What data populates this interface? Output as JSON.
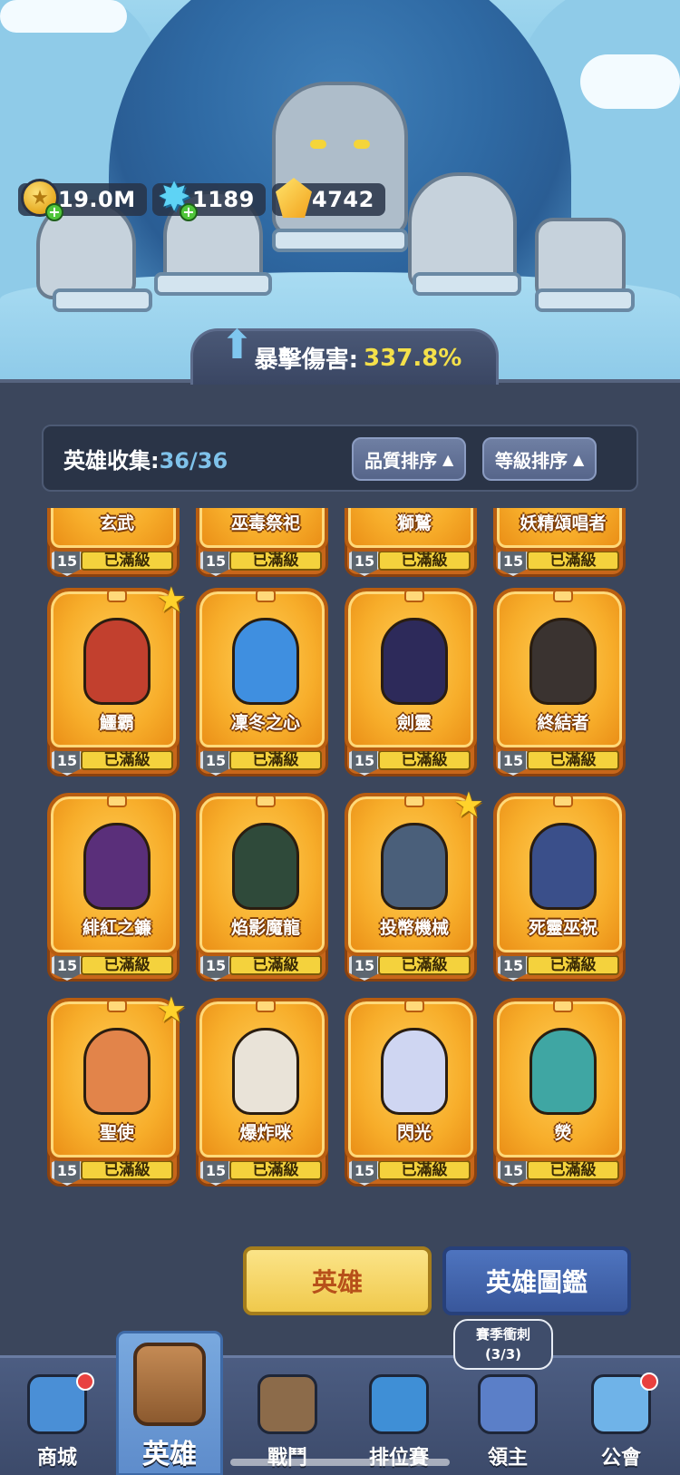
{
  "currencies": {
    "gold": "19.0M",
    "stars": "1189",
    "crystals": "4742"
  },
  "crit_banner": {
    "label": "暴擊傷害:",
    "value": "337.8%"
  },
  "collection": {
    "label": "英雄收集:",
    "count": "36/36",
    "sort_quality": "品質排序",
    "sort_level": "等級排序"
  },
  "heroes": [
    {
      "name": "玄武",
      "level": "15",
      "status": "已滿級",
      "favorite": false
    },
    {
      "name": "巫毒祭祀",
      "level": "15",
      "status": "已滿級",
      "favorite": false
    },
    {
      "name": "獅鷲",
      "level": "15",
      "status": "已滿級",
      "favorite": false
    },
    {
      "name": "妖精頌唱者",
      "level": "15",
      "status": "已滿級",
      "favorite": false
    },
    {
      "name": "鱷霸",
      "level": "15",
      "status": "已滿級",
      "favorite": true
    },
    {
      "name": "凜冬之心",
      "level": "15",
      "status": "已滿級",
      "favorite": false
    },
    {
      "name": "劍靈",
      "level": "15",
      "status": "已滿級",
      "favorite": false
    },
    {
      "name": "終結者",
      "level": "15",
      "status": "已滿級",
      "favorite": false
    },
    {
      "name": "緋紅之鐮",
      "level": "15",
      "status": "已滿級",
      "favorite": false
    },
    {
      "name": "焰影魔龍",
      "level": "15",
      "status": "已滿級",
      "favorite": false
    },
    {
      "name": "投幣機械",
      "level": "15",
      "status": "已滿級",
      "favorite": true
    },
    {
      "name": "死靈巫祝",
      "level": "15",
      "status": "已滿級",
      "favorite": false
    },
    {
      "name": "聖使",
      "level": "15",
      "status": "已滿級",
      "favorite": true
    },
    {
      "name": "爆炸咪",
      "level": "15",
      "status": "已滿級",
      "favorite": false
    },
    {
      "name": "閃光",
      "level": "15",
      "status": "已滿級",
      "favorite": false
    },
    {
      "name": "熒",
      "level": "15",
      "status": "已滿級",
      "favorite": false
    }
  ],
  "hero_colors": [
    "#8a6a3a",
    "#6b3a8a",
    "#7a6a3a",
    "#5a7ac0",
    "#c2402e",
    "#3f8fe0",
    "#2d2a5a",
    "#3a3330",
    "#5a2f7a",
    "#2f4a3a",
    "#4a5f7a",
    "#3a4f8a",
    "#e2844a",
    "#e9e3d8",
    "#cfd6f2",
    "#3fa6a3"
  ],
  "buttons": {
    "hero": "英雄",
    "codex": "英雄圖鑑"
  },
  "tooltip": {
    "line1": "賽季衝刺",
    "line2": "(3/3)"
  },
  "nav": [
    {
      "label": "商城",
      "icon": "shop-icon",
      "color": "#4a8fd6",
      "dot": true
    },
    {
      "label": "英雄",
      "icon": "hero-card-icon",
      "color": "#c48a54",
      "dot": false
    },
    {
      "label": "戰鬥",
      "icon": "battle-icon",
      "color": "#8c6b4a",
      "dot": false
    },
    {
      "label": "排位賽",
      "icon": "ranked-icon",
      "color": "#3f8fd6",
      "dot": false
    },
    {
      "label": "領主",
      "icon": "lord-banner-icon",
      "color": "#5b7fc8",
      "dot": false
    },
    {
      "label": "公會",
      "icon": "guild-icon",
      "color": "#6fb3e8",
      "dot": true
    }
  ]
}
